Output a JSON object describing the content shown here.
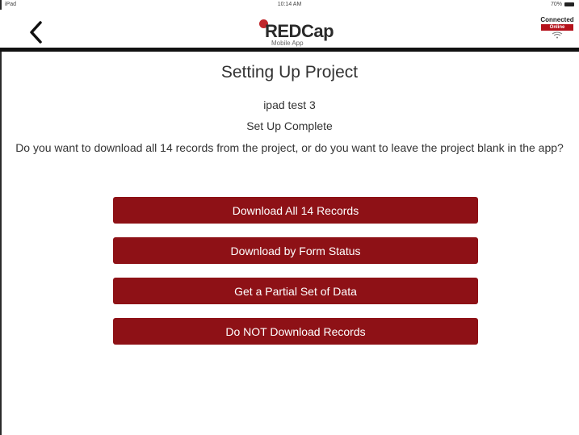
{
  "status_bar": {
    "carrier": "iPad",
    "time": "10:14 AM",
    "battery": "70%"
  },
  "header": {
    "back_icon": "chevron-left-icon",
    "logo_text": "REDCap",
    "logo_subtext": "Mobile App",
    "connection_label": "Connected",
    "connection_status": "Online",
    "wifi_icon": "wifi-icon",
    "brand_color": "#8e1116"
  },
  "main": {
    "title": "Setting Up Project",
    "project_name": "ipad test 3",
    "status": "Set Up Complete",
    "question": "Do you want to download all 14 records from the project, or do you want to leave the project blank in the app?",
    "buttons": [
      {
        "label": "Download All 14 Records"
      },
      {
        "label": "Download by Form Status"
      },
      {
        "label": "Get a Partial Set of Data"
      },
      {
        "label": "Do NOT Download Records"
      }
    ]
  }
}
